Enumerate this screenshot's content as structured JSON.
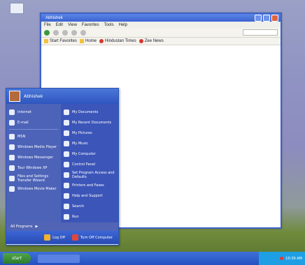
{
  "window": {
    "title": "Abhishek",
    "menu": [
      "File",
      "Edit",
      "View",
      "Favorites",
      "Tools",
      "Help"
    ],
    "favorites": [
      "Start Favorites",
      "Home",
      "Hindustan Times",
      "Zee News"
    ]
  },
  "start_menu": {
    "user": "Abhishek",
    "left_items": [
      "Internet",
      "E-mail",
      "MSN",
      "Windows Media Player",
      "Windows Messenger",
      "Tour Windows XP",
      "Files and Settings Transfer Wizard",
      "Windows Movie Maker"
    ],
    "right_items": [
      "My Documents",
      "My Recent Documents",
      "My Pictures",
      "My Music",
      "My Computer",
      "Control Panel",
      "Set Program Access and Defaults",
      "Printers and Faxes",
      "Help and Support",
      "Search",
      "Run"
    ],
    "all_programs": "All Programs",
    "log_off": "Log Off",
    "turn_off": "Turn Off Computer"
  },
  "taskbar": {
    "start": "start",
    "clock": "10:39 AM"
  },
  "colors": {
    "xp_blue": "#3b62d2",
    "start_green": "#2d7c2a",
    "tray_blue": "#1f9fe3"
  }
}
